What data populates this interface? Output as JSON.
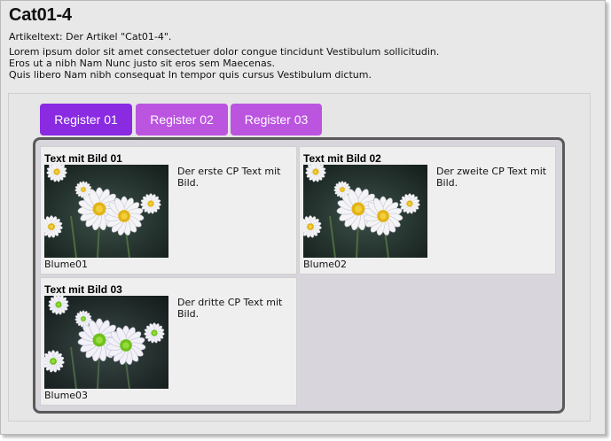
{
  "page": {
    "title": "Cat01-4",
    "artikeltext": "Artikeltext: Der Artikel \"Cat01-4\".",
    "lorem_lines": [
      "Lorem ipsum dolor sit amet consectetuer dolor congue tincidunt Vestibulum sollicitudin.",
      "Eros ut a nibh Nam Nunc justo sit eros sem Maecenas.",
      "Quis libero Nam nibh consequat In tempor quis cursus Vestibulum dictum."
    ]
  },
  "tabs": [
    {
      "label": "Register 01",
      "state": "active"
    },
    {
      "label": "Register 02",
      "state": "inactive"
    },
    {
      "label": "Register 03",
      "state": "inactive"
    }
  ],
  "colors": {
    "tab_active": "#8a2be2",
    "tab_inactive": "#bb55e0",
    "panel_border": "#5a5a5a",
    "panel_bg": "#d8d5dc"
  },
  "cards": [
    {
      "title": "Text mit Bild 01",
      "text": "Der erste CP Text mit Bild.",
      "caption": "Blume01",
      "image": "daisy-flowers-image"
    },
    {
      "title": "Text mit Bild 02",
      "text": "Der zweite CP Text mit Bild.",
      "caption": "Blume02",
      "image": "daisy-flowers-image"
    },
    {
      "title": "Text mit Bild 03",
      "text": "Der dritte CP Text mit Bild.",
      "caption": "Blume03",
      "image": "daisy-flowers-image"
    }
  ]
}
